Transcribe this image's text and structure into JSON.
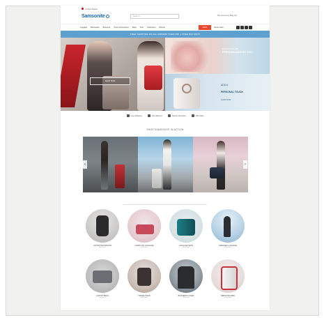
{
  "topbar": {
    "location": "United States"
  },
  "header": {
    "logo": "Samsonite",
    "search_placeholder": "Search",
    "right_links": "My Account  |  Bag (0)"
  },
  "nav": {
    "items": [
      "Luggage",
      "Backpacks",
      "Business",
      "Travel Accessories",
      "Bags",
      "Kids",
      "Collections",
      "Brands"
    ],
    "sale_label": "SALE",
    "right_label": "Stores  Help"
  },
  "banner": {
    "text": "FREE SHIPPING ON ALL ORDERS OVER $50 + FREE RETURNS"
  },
  "hero": {
    "left_cta": "SHOP NOW",
    "top_small": "PERSONALIZE",
    "top_big": "PERSONALIZED BY YOU",
    "bottom_line1": "ADD A",
    "bottom_line2": "PERSONAL TOUCH",
    "bottom_line3": "SHOP NOW"
  },
  "usp": [
    {
      "icon": "truck-icon",
      "label": "Free Shipping"
    },
    {
      "icon": "return-icon",
      "label": "Free Returns"
    },
    {
      "icon": "lock-icon",
      "label": "Secure Checkout"
    },
    {
      "icon": "gift-icon",
      "label": "Gift Cards"
    }
  ],
  "gallery": {
    "title": "SHOP SAMSONITE IN ACTION"
  },
  "categories": [
    {
      "name": "LAPTOP BACKPACKS",
      "sub": "Shop now"
    },
    {
      "name": "CARRY-ON LUGGAGE",
      "sub": "Shop now"
    },
    {
      "name": "LUGGAGE SETS",
      "sub": "Shop now"
    },
    {
      "name": "CHECKED LUGGAGE",
      "sub": "Shop now"
    },
    {
      "name": "LAPTOP BAGS",
      "sub": "Shop now"
    },
    {
      "name": "TRAVEL BAGS",
      "sub": "Shop now"
    },
    {
      "name": "BUSINESS CASES",
      "sub": "Shop now"
    },
    {
      "name": "PERSONALIZED",
      "sub": "Shop now"
    }
  ],
  "colors": {
    "brand_blue": "#1a6aa8",
    "banner_blue": "#5ea0cf",
    "sale_red": "#e8462f"
  }
}
